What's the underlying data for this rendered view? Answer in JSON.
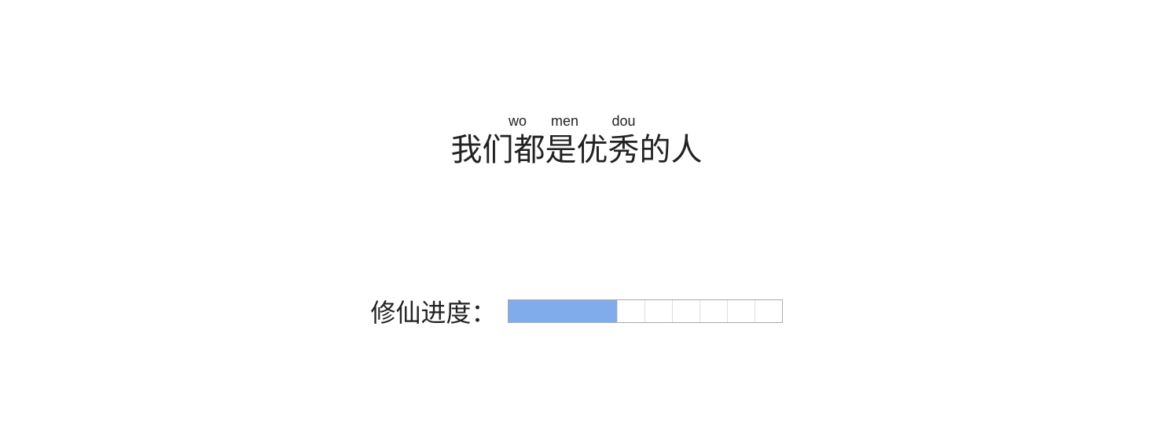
{
  "title": {
    "pinyin": [
      "wo",
      "men",
      "dou"
    ],
    "hanzi": "我们都是优秀的人"
  },
  "progress": {
    "label": "修仙进度：",
    "filled": 4,
    "total": 10,
    "fill_color": "#80acec"
  }
}
